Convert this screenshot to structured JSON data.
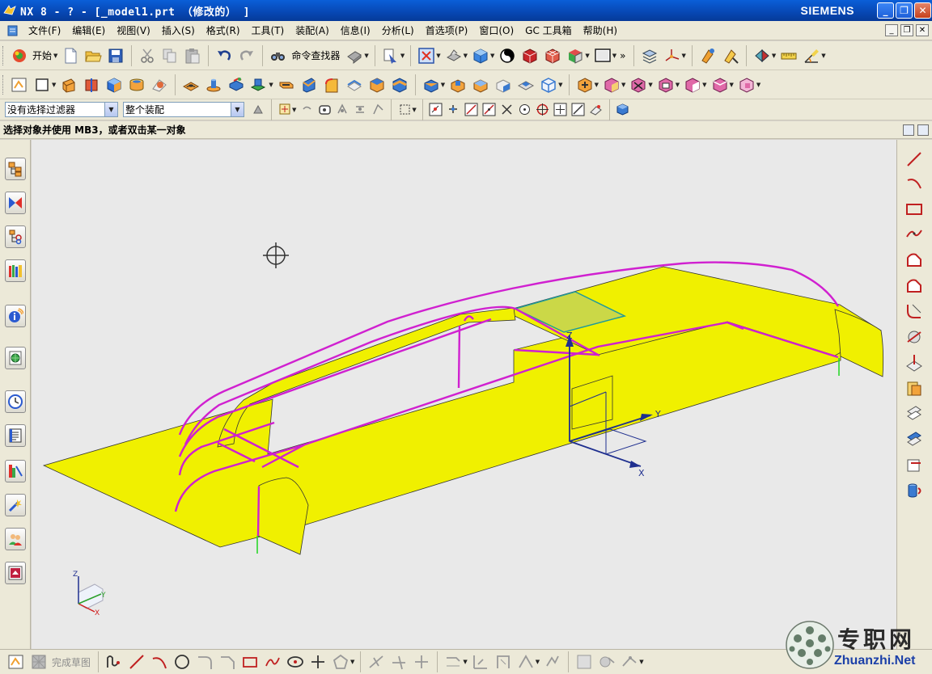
{
  "window": {
    "title": "NX 8 - ? - [_model1.prt （修改的） ]",
    "brand": "SIEMENS",
    "buttons": [
      "_",
      "❐",
      "✕"
    ]
  },
  "menubar": {
    "items": [
      "文件(F)",
      "编辑(E)",
      "视图(V)",
      "插入(S)",
      "格式(R)",
      "工具(T)",
      "装配(A)",
      "信息(I)",
      "分析(L)",
      "首选项(P)",
      "窗口(O)",
      "GC 工具箱",
      "帮助(H)"
    ],
    "mdi_buttons": [
      "_",
      "❐",
      "✕"
    ]
  },
  "standard_toolbar": {
    "start_label": "开始",
    "command_finder_label": "命令查找器",
    "more_label": "»"
  },
  "selection_bar": {
    "filter_value": "没有选择过滤器",
    "scope_value": "整个装配"
  },
  "cue_line": {
    "text": "选择对象并使用 MB3，或者双击某一对象"
  },
  "sketch_bar": {
    "finish_label": "完成草图"
  },
  "viewport": {
    "background": "#e9e9e9",
    "surface_color": "#f0f000",
    "curve_color": "#d020d0",
    "axis_labels": {
      "x": "X",
      "y": "Y",
      "z": "Z"
    },
    "triad_labels": {
      "x": "X",
      "y": "Y",
      "z": "Z"
    }
  },
  "watermark": {
    "cn": "专职网",
    "en": "Zhuanzhi.Net"
  },
  "colors": {
    "title_blue": "#0747b3",
    "panel": "#ece9d8",
    "accent_orange": "#f0a030"
  }
}
